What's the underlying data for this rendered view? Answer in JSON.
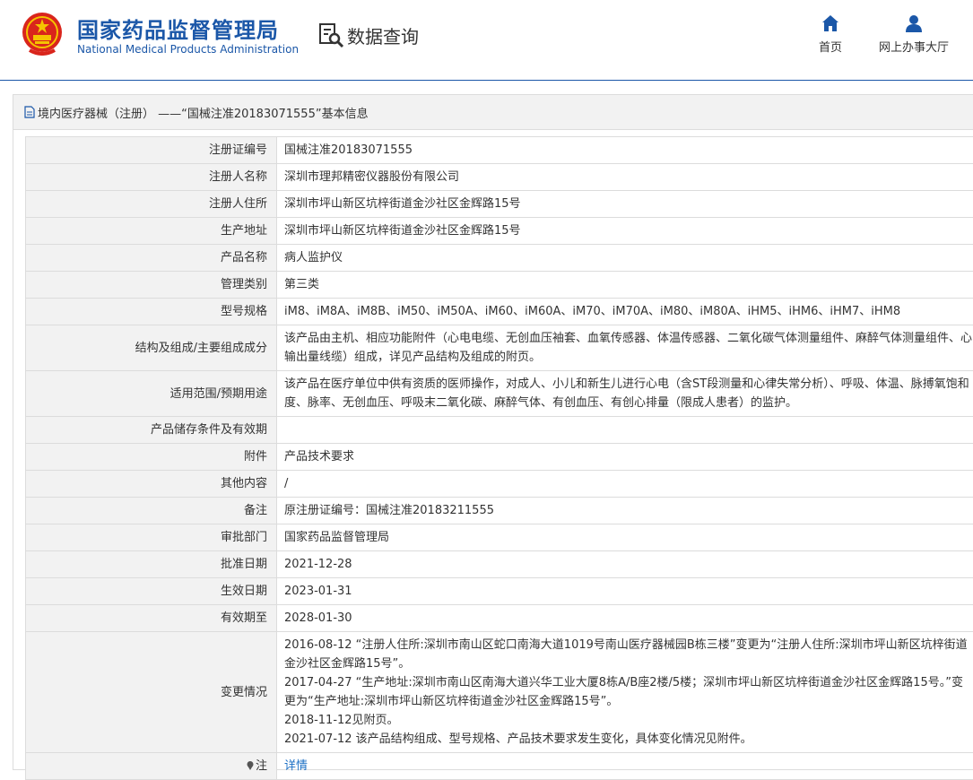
{
  "header": {
    "org_name_cn": "国家药品监督管理局",
    "org_name_en": "National Medical Products Administration",
    "section_title": "数据查询",
    "nav": [
      {
        "label": "首页",
        "icon": "home-icon"
      },
      {
        "label": "网上办事大厅",
        "icon": "user-icon"
      }
    ]
  },
  "panel": {
    "title": "境内医疗器械（注册） ——“国械注准20183071555”基本信息"
  },
  "rows": [
    {
      "label": "注册证编号",
      "value": "国械注准20183071555"
    },
    {
      "label": "注册人名称",
      "value": "深圳市理邦精密仪器股份有限公司"
    },
    {
      "label": "注册人住所",
      "value": "深圳市坪山新区坑梓街道金沙社区金辉路15号"
    },
    {
      "label": "生产地址",
      "value": "深圳市坪山新区坑梓街道金沙社区金辉路15号"
    },
    {
      "label": "产品名称",
      "value": "病人监护仪"
    },
    {
      "label": "管理类别",
      "value": "第三类"
    },
    {
      "label": "型号规格",
      "value": "iM8、iM8A、iM8B、iM50、iM50A、iM60、iM60A、iM70、iM70A、iM80、iM80A、iHM5、iHM6、iHM7、iHM8"
    },
    {
      "label": "结构及组成/主要组成成分",
      "value": "该产品由主机、相应功能附件（心电电缆、无创血压袖套、血氧传感器、体温传感器、二氧化碳气体测量组件、麻醉气体测量组件、心输出量线缆）组成，详见产品结构及组成的附页。"
    },
    {
      "label": "适用范围/预期用途",
      "value": "该产品在医疗单位中供有资质的医师操作，对成人、小儿和新生儿进行心电（含ST段测量和心律失常分析）、呼吸、体温、脉搏氧饱和度、脉率、无创血压、呼吸末二氧化碳、麻醉气体、有创血压、有创心排量（限成人患者）的监护。"
    },
    {
      "label": "产品储存条件及有效期",
      "value": ""
    },
    {
      "label": "附件",
      "value": "产品技术要求"
    },
    {
      "label": "其他内容",
      "value": "/"
    },
    {
      "label": "备注",
      "value": "原注册证编号：国械注准20183211555"
    },
    {
      "label": "审批部门",
      "value": "国家药品监督管理局"
    },
    {
      "label": "批准日期",
      "value": "2021-12-28"
    },
    {
      "label": "生效日期",
      "value": "2023-01-31"
    },
    {
      "label": "有效期至",
      "value": "2028-01-30"
    }
  ],
  "change_history": {
    "label": "变更情况",
    "lines": [
      "2016-08-12 “注册人住所:深圳市南山区蛇口南海大道1019号南山医疗器械园B栋三楼”变更为“注册人住所:深圳市坪山新区坑梓街道金沙社区金辉路15号”。",
      "2017-04-27 “生产地址:深圳市南山区南海大道兴华工业大厦8栋A/B座2楼/5楼；深圳市坪山新区坑梓街道金沙社区金辉路15号。”变更为“生产地址:深圳市坪山新区坑梓街道金沙社区金辉路15号”。",
      "2018-11-12见附页。",
      "2021-07-12 该产品结构组成、型号规格、产品技术要求发生变化，具体变化情况见附件。"
    ]
  },
  "note": {
    "label": "注",
    "link_text": "详情",
    "icon": "pin-icon"
  },
  "colors": {
    "brand_blue": "#1b57a8",
    "label_bg": "#f2f2f2",
    "border": "#dcdcdc",
    "link": "#1b6fc4"
  }
}
